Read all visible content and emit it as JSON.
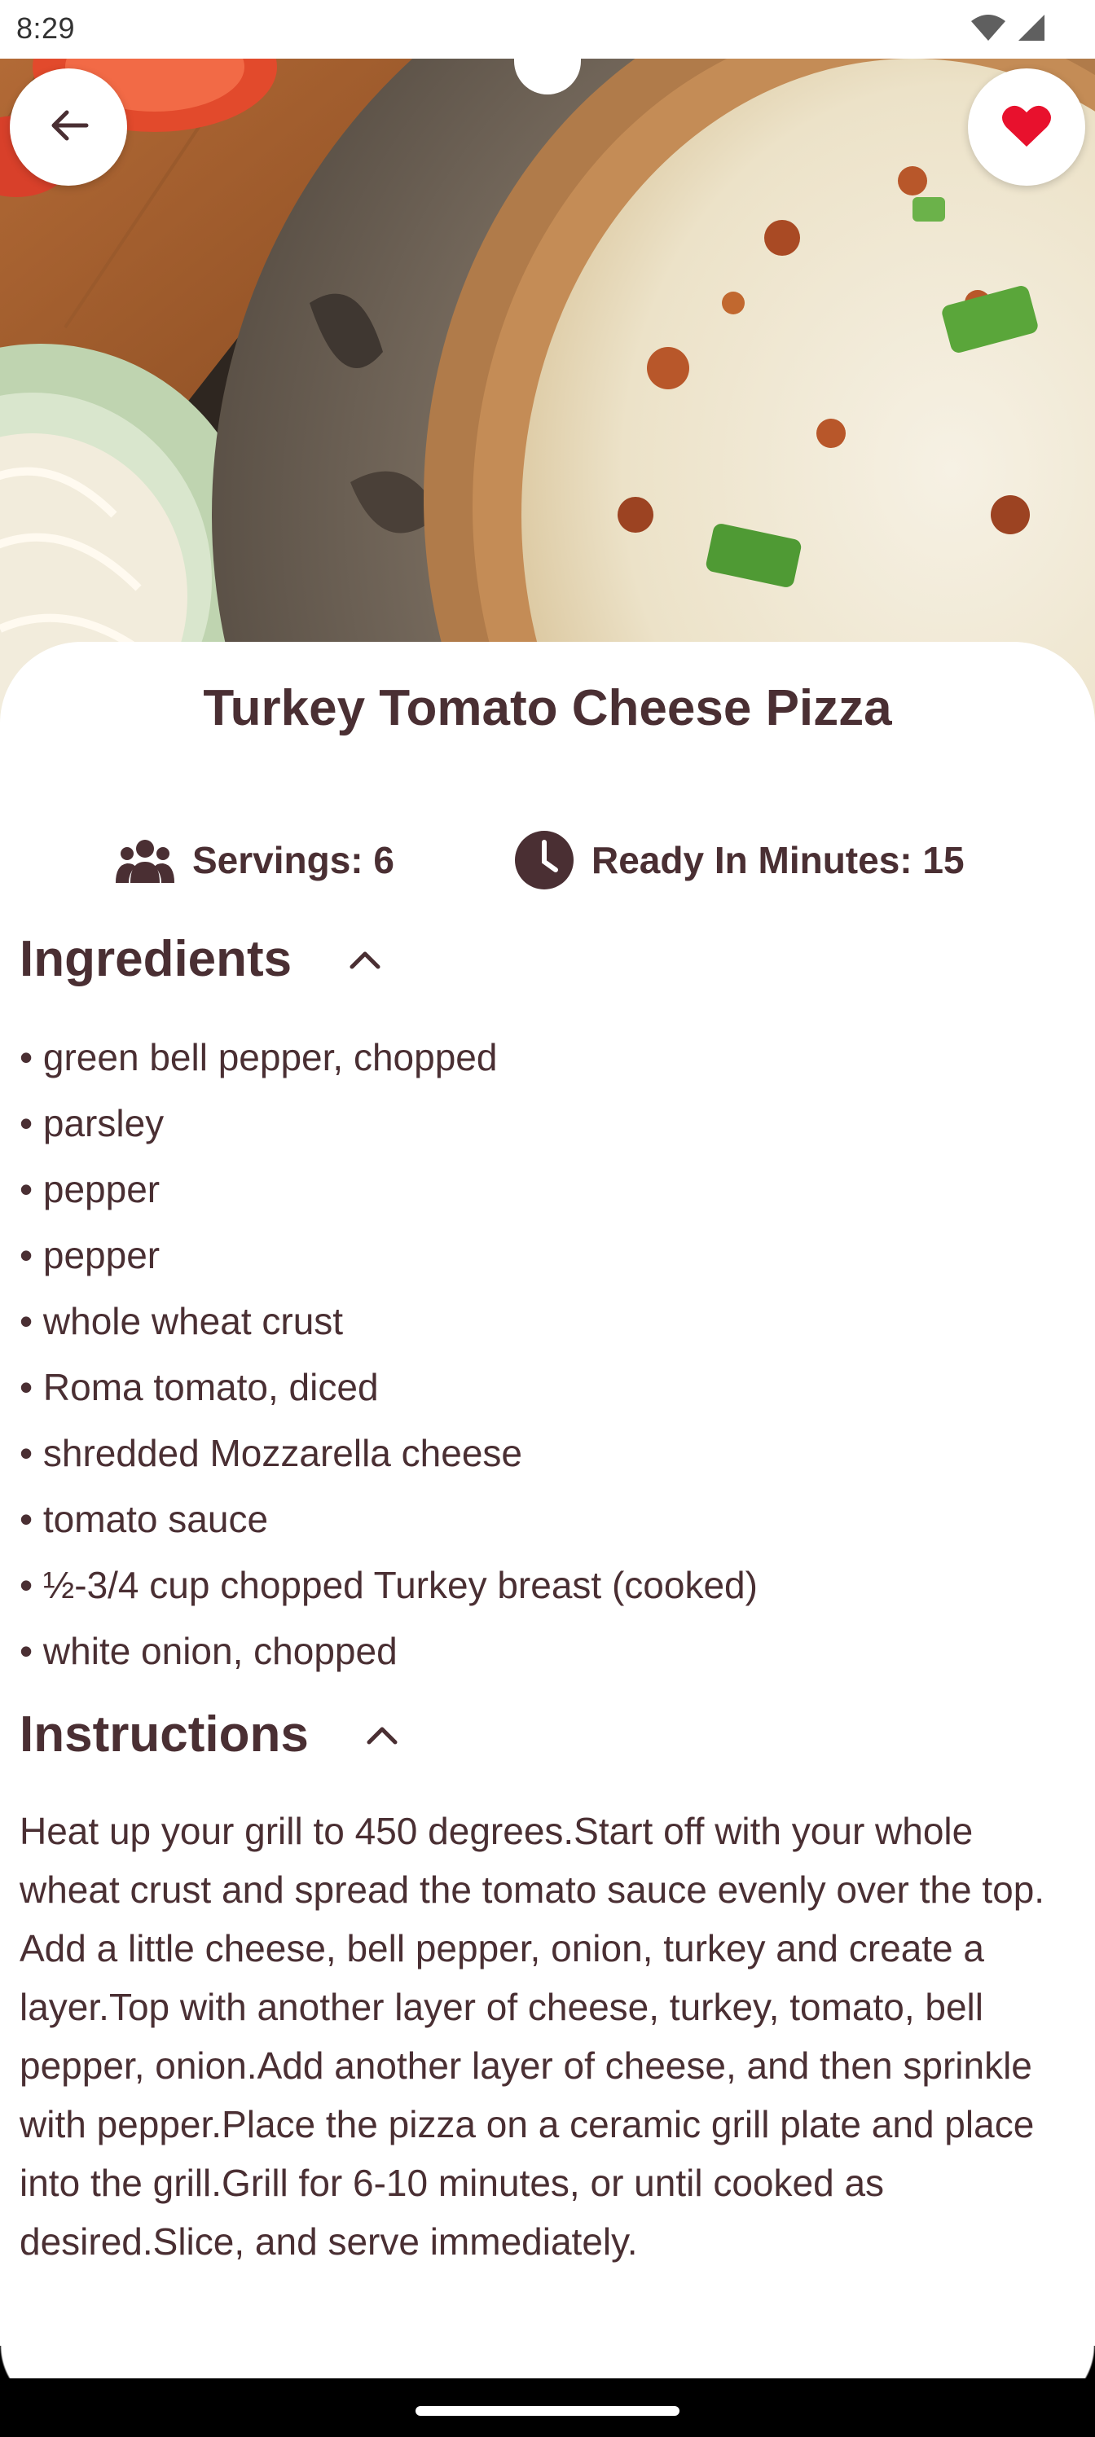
{
  "status_bar": {
    "time": "8:29",
    "icons": [
      "wifi-icon",
      "cell-signal-icon"
    ]
  },
  "header": {
    "back_icon": "arrow-left-icon",
    "favorite_icon": "heart-icon",
    "favorite_color": "#e8112d"
  },
  "recipe": {
    "title": "Turkey Tomato Cheese Pizza",
    "servings_label": "Servings: 6",
    "ready_label": "Ready In Minutes: 15"
  },
  "ingredients": {
    "heading": "Ingredients",
    "items": [
      "• green bell pepper, chopped",
      "• parsley",
      "• pepper",
      "• pepper",
      "• whole wheat crust",
      "• Roma tomato, diced",
      "• shredded Mozzarella cheese",
      "• tomato sauce",
      "• ½-3/4 cup chopped Turkey breast (cooked)",
      "• white onion, chopped"
    ]
  },
  "instructions": {
    "heading": "Instructions",
    "text": "Heat up your grill to 450 degrees.Start off with your whole wheat crust and spread the tomato sauce evenly over the top. Add a little cheese, bell pepper, onion, turkey and create a layer.Top with another layer of cheese, turkey, tomato, bell pepper, onion.Add another layer of cheese, and then sprinkle with pepper.Place the pizza on a ceramic grill plate and place into the grill.Grill for 6-10 minutes, or until cooked as desired.Slice, and serve immediately."
  },
  "colors": {
    "text_primary": "#4a2f33",
    "background": "#ffffff"
  }
}
